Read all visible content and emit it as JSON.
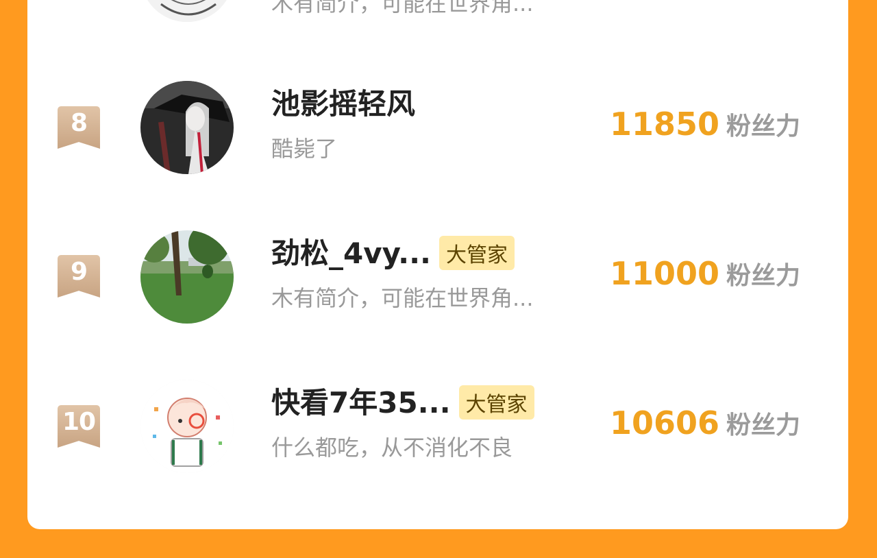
{
  "partial_top_row": {
    "bio": "木有简介，可能在世界角..."
  },
  "rows": [
    {
      "rank": "8",
      "name": "池影摇轻风",
      "bio": "酷毙了",
      "score": "11850",
      "score_label": "粉丝力",
      "badge": ""
    },
    {
      "rank": "9",
      "name": "劲松_4vy...",
      "bio": "木有简介，可能在世界角...",
      "score": "11000",
      "score_label": "粉丝力",
      "badge": "大管家"
    },
    {
      "rank": "10",
      "name": "快看7年35...",
      "bio": "什么都吃，从不消化不良",
      "score": "10606",
      "score_label": "粉丝力",
      "badge": "大管家"
    }
  ],
  "colors": {
    "background": "#FF9A1F",
    "score": "#F0A21F",
    "badge_bg": "#FFEAA8"
  }
}
